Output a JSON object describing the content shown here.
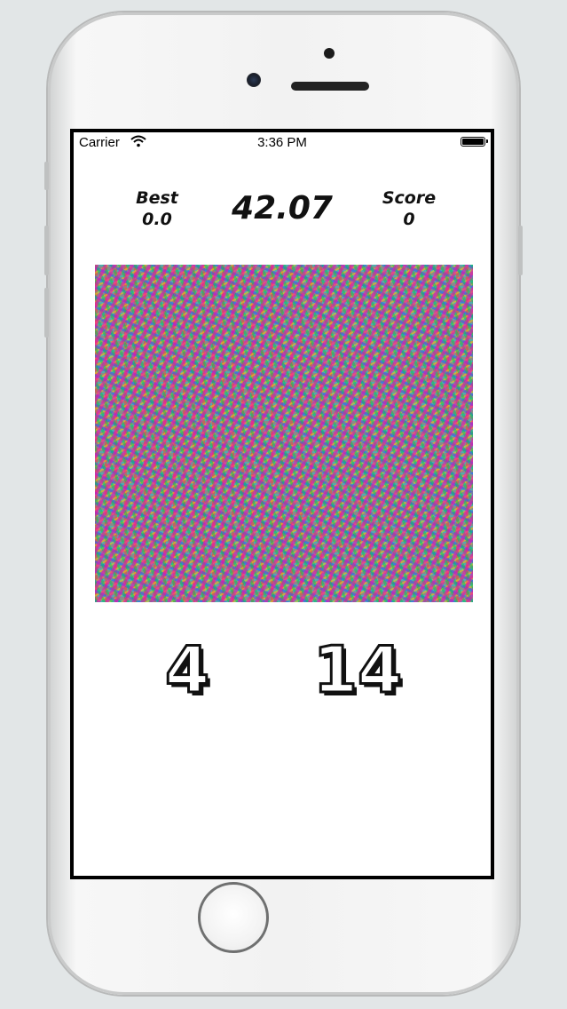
{
  "status_bar": {
    "carrier": "Carrier",
    "time": "3:36 PM",
    "wifi_icon": "wifi-icon",
    "battery_icon": "battery-icon"
  },
  "game": {
    "best_label": "Best",
    "best_value": "0.0",
    "timer": "42.07",
    "score_label": "Score",
    "score_value": "0",
    "answers": [
      "4",
      "14"
    ]
  },
  "colors": {
    "screen_bg": "#ffffff",
    "frame": "#000000",
    "text": "#111111"
  }
}
